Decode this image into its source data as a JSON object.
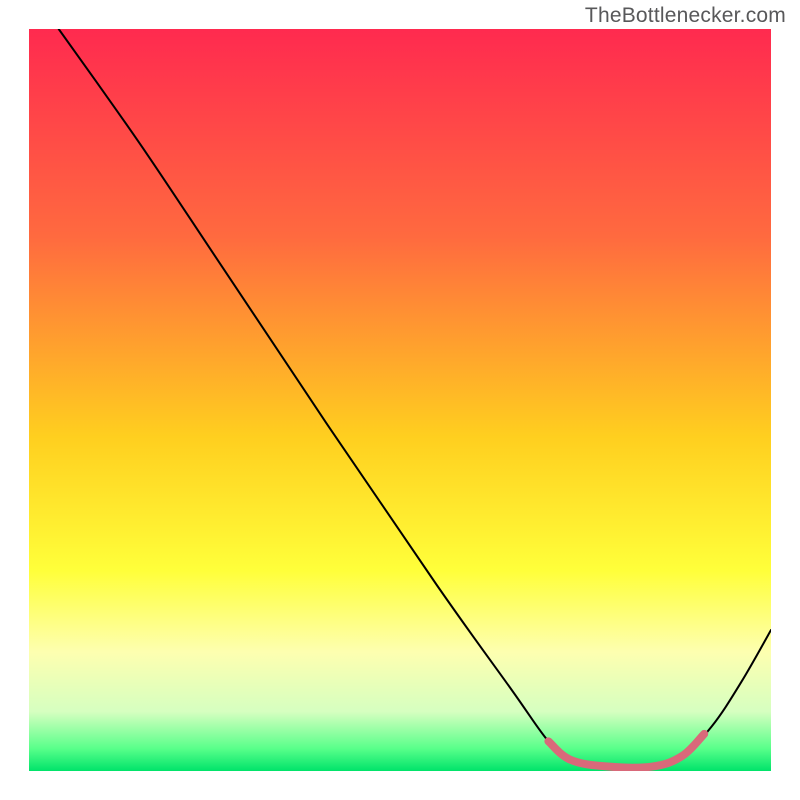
{
  "watermark": "TheBottlenecker.com",
  "chart_data": {
    "type": "line",
    "title": "",
    "xlabel": "",
    "ylabel": "",
    "xlim": [
      0,
      100
    ],
    "ylim": [
      0,
      100
    ],
    "gradient": {
      "stops": [
        {
          "offset": 0,
          "color": "#ff2a4f"
        },
        {
          "offset": 28,
          "color": "#ff6a3f"
        },
        {
          "offset": 55,
          "color": "#ffcf1f"
        },
        {
          "offset": 73,
          "color": "#ffff3a"
        },
        {
          "offset": 84,
          "color": "#fdffb0"
        },
        {
          "offset": 92,
          "color": "#d6ffc0"
        },
        {
          "offset": 97,
          "color": "#58ff8a"
        },
        {
          "offset": 100,
          "color": "#00e36a"
        }
      ]
    },
    "series": [
      {
        "name": "bottleneck-curve",
        "color": "#000000",
        "width": 2,
        "points": [
          {
            "x": 4,
            "y": 100
          },
          {
            "x": 9,
            "y": 93
          },
          {
            "x": 16,
            "y": 83
          },
          {
            "x": 26,
            "y": 68
          },
          {
            "x": 40,
            "y": 47
          },
          {
            "x": 55,
            "y": 25
          },
          {
            "x": 65,
            "y": 11
          },
          {
            "x": 70,
            "y": 4
          },
          {
            "x": 73,
            "y": 1.5
          },
          {
            "x": 78,
            "y": 0.6
          },
          {
            "x": 84,
            "y": 0.6
          },
          {
            "x": 88,
            "y": 2
          },
          {
            "x": 92,
            "y": 6
          },
          {
            "x": 96,
            "y": 12
          },
          {
            "x": 100,
            "y": 19
          }
        ]
      },
      {
        "name": "optimal-zone",
        "color": "#d9697a",
        "width": 8,
        "linecap": "round",
        "points": [
          {
            "x": 70,
            "y": 4
          },
          {
            "x": 73,
            "y": 1.5
          },
          {
            "x": 78,
            "y": 0.6
          },
          {
            "x": 84,
            "y": 0.6
          },
          {
            "x": 88,
            "y": 2
          },
          {
            "x": 91,
            "y": 5
          }
        ]
      }
    ]
  }
}
